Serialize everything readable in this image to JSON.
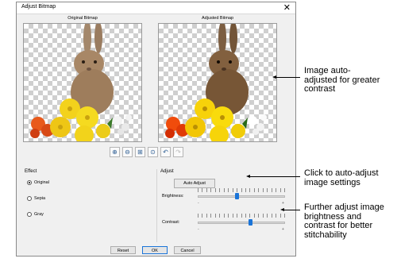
{
  "dialog": {
    "title": "Adjust Bitmap",
    "close_icon": "close-icon",
    "original_label": "Original Bitmap",
    "adjusted_label": "Adjusted Bitmap",
    "toolbar_icons": [
      "zoom-in-icon",
      "zoom-out-icon",
      "zoom-fit-icon",
      "zoom-actual-icon",
      "undo-icon",
      "redo-icon"
    ]
  },
  "effect": {
    "heading": "Effect",
    "options": [
      {
        "label": "Original",
        "selected": true
      },
      {
        "label": "Sepia",
        "selected": false
      },
      {
        "label": "Gray",
        "selected": false
      }
    ]
  },
  "adjust": {
    "heading": "Adjust",
    "auto_button": "Auto Adjust",
    "brightness_label": "Brightness:",
    "brightness_level": 0.45,
    "contrast_label": "Contrast:",
    "contrast_level": 0.6,
    "min_mark": "-",
    "max_mark": "+"
  },
  "buttons": {
    "reset": "Reset",
    "ok": "OK",
    "cancel": "Cancel"
  },
  "annotations": {
    "preview_note": [
      "Image auto-",
      "adjusted for greater",
      "contrast"
    ],
    "auto_note": [
      "Click to auto-adjust",
      "image settings"
    ],
    "slider_note": [
      "Further adjust image",
      "brightness and",
      "contrast for better",
      "stitchability"
    ]
  }
}
